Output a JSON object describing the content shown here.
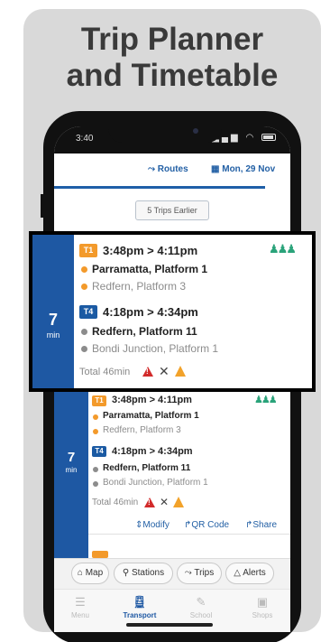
{
  "promo": {
    "title_line1": "Trip Planner",
    "title_line2": "and Timetable"
  },
  "status_bar": {
    "time": "3:40"
  },
  "header": {
    "routes_label": "Routes",
    "date_label": "Mon, 29 Nov"
  },
  "earlier_button": "5 Trips Earlier",
  "highlighted_trip": {
    "duration_value": "7",
    "duration_unit": "min",
    "leg1": {
      "line": "T1",
      "time": "3:48pm > 4:11pm",
      "from": "Parramatta, Platform 1",
      "to": "Redfern, Platform 3"
    },
    "leg2": {
      "line": "T4",
      "time": "4:18pm > 4:34pm",
      "from": "Redfern, Platform 11",
      "to": "Bondi Junction, Platform 1"
    },
    "total": "Total 46min"
  },
  "trip2": {
    "duration_value": "7",
    "duration_unit": "min",
    "leg1": {
      "line": "T1",
      "time": "3:48pm > 4:11pm",
      "from": "Parramatta, Platform 1",
      "to": "Redfern, Platform 3"
    },
    "leg2": {
      "line": "T4",
      "time": "4:18pm > 4:34pm",
      "from": "Redfern, Platform 11",
      "to": "Bondi Junction, Platform 1"
    },
    "total": "Total 46min",
    "actions": {
      "modify": "Modify",
      "qr_code": "QR Code",
      "share": "Share"
    }
  },
  "quick_actions": {
    "map": "Map",
    "stations": "Stations",
    "trips": "Trips",
    "alerts": "Alerts"
  },
  "tabs": {
    "menu": "Menu",
    "transport": "Transport",
    "school": "School",
    "shops": "Shops"
  },
  "colors": {
    "primary": "#1e58a3",
    "t1": "#f39a2b",
    "t4": "#1b5aa3",
    "alert": "#d22a2a",
    "occupancy": "#2aa37a"
  }
}
